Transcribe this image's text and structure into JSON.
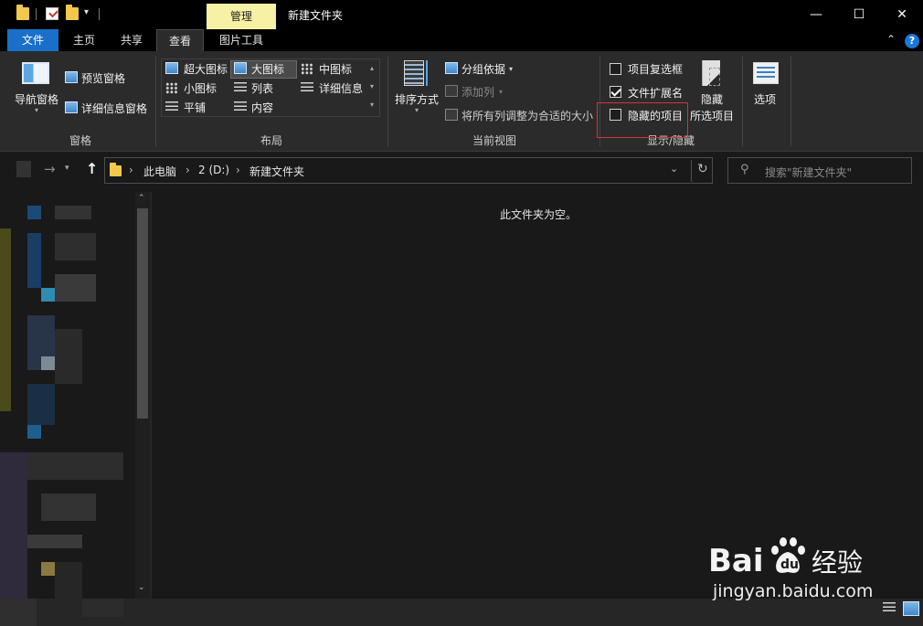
{
  "titlebar": {
    "window_title": "新建文件夹",
    "contextual_tab": "管理",
    "controls": {
      "minimize": "—",
      "maximize": "☐",
      "close": "✕"
    }
  },
  "tabs": [
    "文件",
    "主页",
    "共享",
    "查看",
    "图片工具"
  ],
  "active_tab": "查看",
  "ribbon": {
    "panes": {
      "label": "窗格",
      "navigation_pane": "导航窗格",
      "preview_pane": "预览窗格",
      "details_pane": "详细信息窗格"
    },
    "layout": {
      "label": "布局",
      "items": [
        "超大图标",
        "大图标",
        "中图标",
        "小图标",
        "列表",
        "详细信息",
        "平铺",
        "内容"
      ],
      "selected": "大图标"
    },
    "current_view": {
      "label": "当前视图",
      "sort_by": "排序方式",
      "group_by": "分组依据",
      "add_columns": "添加列",
      "size_all_columns": "将所有列调整为合适的大小"
    },
    "show_hide": {
      "label": "显示/隐藏",
      "item_checkboxes": {
        "label": "项目复选框",
        "checked": false
      },
      "file_name_extensions": {
        "label": "文件扩展名",
        "checked": true
      },
      "hidden_items": {
        "label": "隐藏的项目",
        "checked": false
      },
      "hide_selected_line1": "隐藏",
      "hide_selected_line2": "所选项目"
    },
    "options": "选项"
  },
  "address": {
    "crumbs": [
      "此电脑",
      "2 (D:)",
      "新建文件夹"
    ]
  },
  "search": {
    "placeholder": "搜索\"新建文件夹\""
  },
  "content": {
    "empty_message": "此文件夹为空。"
  },
  "watermark": {
    "brand": "Bai",
    "brand2": "du",
    "cn": "经验",
    "url": "jingyan.baidu.com"
  },
  "colors": {
    "accent": "#1a6fc8",
    "manage_tab": "#f6f1a4",
    "highlight": "#d9352b",
    "background": "#191919"
  }
}
